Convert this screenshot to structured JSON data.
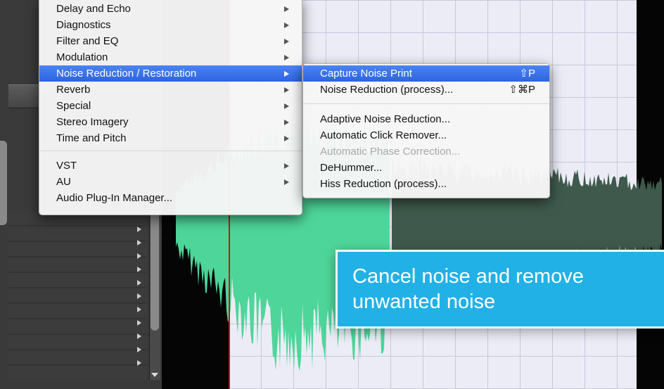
{
  "main_menu": {
    "items": [
      {
        "label": "Delay and Echo",
        "submenu": true
      },
      {
        "label": "Diagnostics",
        "submenu": true
      },
      {
        "label": "Filter and EQ",
        "submenu": true
      },
      {
        "label": "Modulation",
        "submenu": true
      },
      {
        "label": "Noise Reduction / Restoration",
        "submenu": true,
        "highlighted": true
      },
      {
        "label": "Reverb",
        "submenu": true
      },
      {
        "label": "Special",
        "submenu": true
      },
      {
        "label": "Stereo Imagery",
        "submenu": true
      },
      {
        "label": "Time and Pitch",
        "submenu": true
      },
      {
        "label": "VST",
        "submenu": true
      },
      {
        "label": "AU",
        "submenu": true
      },
      {
        "label": "Audio Plug-In Manager...",
        "submenu": false
      }
    ]
  },
  "sub_menu": {
    "items": [
      {
        "label": "Capture Noise Print",
        "shortcut": "⇧P",
        "highlighted": true
      },
      {
        "label": "Noise Reduction (process)...",
        "shortcut": "⇧⌘P"
      },
      {
        "label": "Adaptive Noise Reduction..."
      },
      {
        "label": "Automatic Click Remover..."
      },
      {
        "label": "Automatic Phase Correction...",
        "disabled": true
      },
      {
        "label": "DeHummer..."
      },
      {
        "label": "Hiss Reduction (process)..."
      }
    ]
  },
  "callout": {
    "line1": "Cancel noise and remove",
    "line2": "unwanted noise"
  },
  "colors": {
    "highlight": "#3a6ff0",
    "callout": "#22b1e6",
    "waveform_selected": "#4ed69a",
    "waveform_unselected": "#3f5a4c",
    "playhead": "#c4161c"
  },
  "icons": {
    "submenu_arrow": "triangle-right-icon",
    "scroll_down": "triangle-down-icon"
  }
}
